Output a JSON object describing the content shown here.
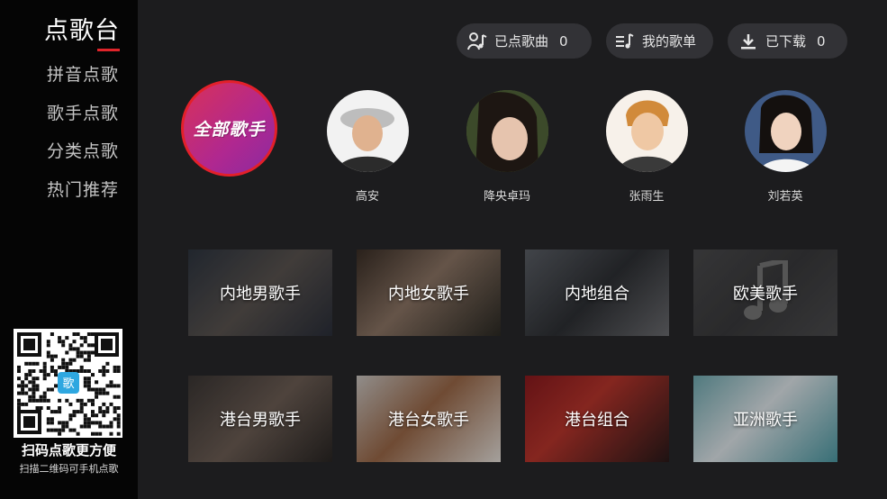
{
  "sidebar": {
    "title": "点歌台",
    "items": [
      {
        "label": "拼音点歌"
      },
      {
        "label": "歌手点歌"
      },
      {
        "label": "分类点歌"
      },
      {
        "label": "热门推荐"
      }
    ],
    "qr_badge": "歌",
    "qr_caption": "扫码点歌更方便",
    "qr_subcaption": "扫描二维码可手机点歌"
  },
  "topbar": {
    "requested": {
      "label": "已点歌曲",
      "count": "0",
      "icon": "mic-person-icon"
    },
    "my_songs": {
      "label": "我的歌单",
      "icon": "playlist-icon"
    },
    "downloaded": {
      "label": "已下载",
      "count": "0",
      "icon": "download-icon"
    }
  },
  "singers": {
    "all_label": "全部歌手",
    "featured": [
      {
        "name": "高安"
      },
      {
        "name": "降央卓玛"
      },
      {
        "name": "张雨生"
      },
      {
        "name": "刘若英"
      }
    ]
  },
  "categories": [
    {
      "label": "内地男歌手"
    },
    {
      "label": "内地女歌手"
    },
    {
      "label": "内地组合"
    },
    {
      "label": "欧美歌手"
    },
    {
      "label": "港台男歌手"
    },
    {
      "label": "港台女歌手"
    },
    {
      "label": "港台组合"
    },
    {
      "label": "亚洲歌手"
    }
  ],
  "colors": {
    "accent": "#e0242a",
    "sidebar_bg": "#050505",
    "main_bg": "#1c1c1e",
    "pill_bg": "#323236"
  }
}
